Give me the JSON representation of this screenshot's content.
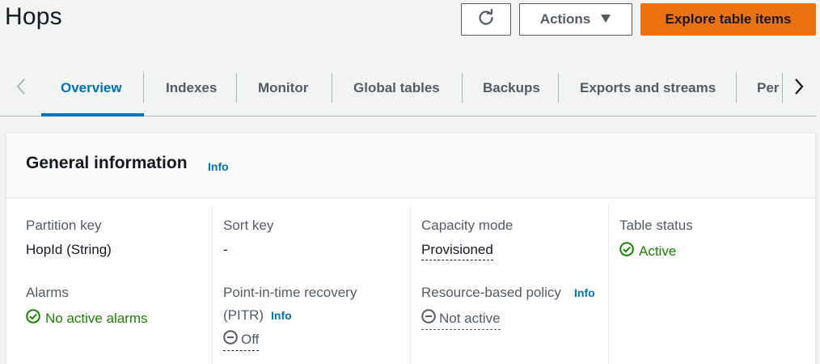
{
  "page": {
    "title": "Hops"
  },
  "header_actions": {
    "refresh_icon": "refresh-icon",
    "actions_label": "Actions",
    "explore_label": "Explore table items",
    "accent_color": "#ec7211"
  },
  "tabs": [
    {
      "label": "Overview",
      "active": true
    },
    {
      "label": "Indexes"
    },
    {
      "label": "Monitor"
    },
    {
      "label": "Global tables"
    },
    {
      "label": "Backups"
    },
    {
      "label": "Exports and streams"
    },
    {
      "label": "Permissions"
    }
  ],
  "tab_clipped_text": "Per",
  "general_info": {
    "title": "General information",
    "info_label": "Info",
    "partition_key": {
      "label": "Partition key",
      "value": "HopId (String)"
    },
    "sort_key": {
      "label": "Sort key",
      "value": "-"
    },
    "capacity_mode": {
      "label": "Capacity mode",
      "value": "Provisioned"
    },
    "table_status": {
      "label": "Table status",
      "value": "Active"
    },
    "alarms": {
      "label": "Alarms",
      "value": "No active alarms"
    },
    "pitr": {
      "label_line1": "Point-in-time recovery",
      "label_line2": "(PITR)",
      "info_label": "Info",
      "value": "Off"
    },
    "resource_policy": {
      "label": "Resource-based policy",
      "info_label": "Info",
      "value": "Not active"
    }
  },
  "colors": {
    "success": "#1d8102",
    "link": "#0073bb",
    "muted": "#545b64"
  }
}
